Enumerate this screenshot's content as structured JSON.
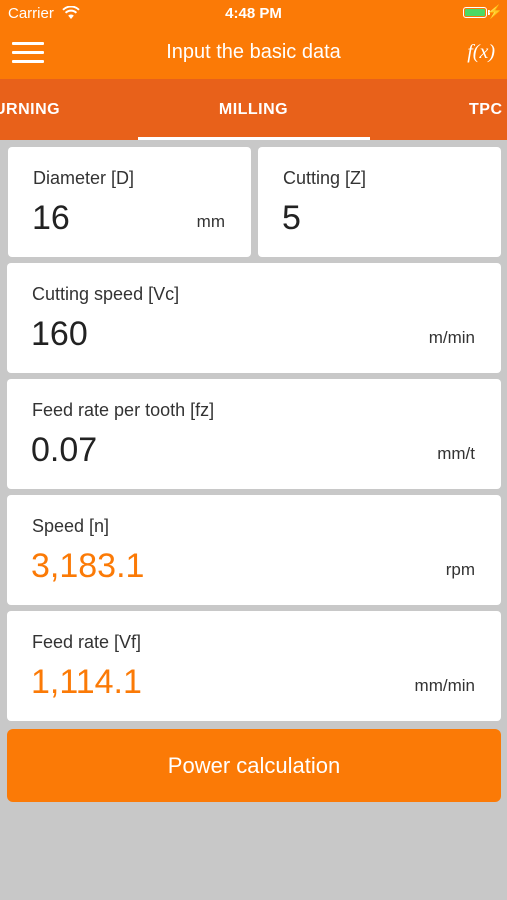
{
  "status_bar": {
    "carrier": "Carrier",
    "time": "4:48 PM",
    "charge_symbol": "⚡",
    "battery_level": 1.0,
    "battery_color": "#4cd964"
  },
  "nav": {
    "title": "Input the basic data",
    "menu_icon": "hamburger-icon",
    "fx_label": "f(x)"
  },
  "tabs": [
    {
      "label": "URNING"
    },
    {
      "label": "MILLING",
      "active": true
    },
    {
      "label": "TPC"
    }
  ],
  "fields": {
    "diameter": {
      "label": "Diameter [D]",
      "value": "16",
      "unit": "mm"
    },
    "cutting": {
      "label": "Cutting [Z]",
      "value": "5"
    },
    "cutting_speed": {
      "label": "Cutting speed [Vc]",
      "value": "160",
      "unit": "m/min"
    },
    "feed_rate_tooth": {
      "label": "Feed rate per tooth [fz]",
      "value": "0.07",
      "unit": "mm/t"
    },
    "speed": {
      "label": "Speed [n]",
      "value": "3,183.1",
      "unit": "rpm"
    },
    "feed_rate": {
      "label": "Feed rate [Vf]",
      "value": "1,114.1",
      "unit": "mm/min"
    }
  },
  "power_button": {
    "label": "Power calculation"
  },
  "colors": {
    "accent": "#fb7a06",
    "tab_bar": "#e8611a",
    "background": "#c8c8c8",
    "result_value": "#fb7a06"
  }
}
